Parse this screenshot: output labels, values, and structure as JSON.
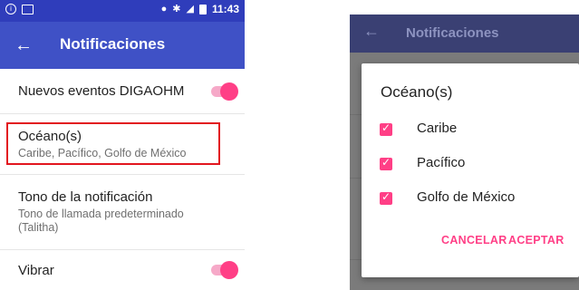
{
  "left_screen": {
    "statusbar": {
      "time": "11:43",
      "left_icons": [
        "info-icon",
        "image-icon"
      ],
      "right_icons": [
        "location-icon",
        "bluetooth-icon",
        "signal-icon",
        "battery-icon"
      ]
    },
    "appbar": {
      "title": "Notificaciones"
    },
    "settings": [
      {
        "label": "Nuevos eventos DIGAOHM",
        "toggle_on": true
      },
      {
        "label": "Océano(s)",
        "summary": "Caribe, Pacífico, Golfo de México"
      },
      {
        "label": "Tono de la notificación",
        "summary": "Tono de llamada predeterminado (Talitha)"
      },
      {
        "label": "Vibrar",
        "toggle_on": true
      }
    ],
    "accent_color": "#ff3f86",
    "appbar_color": "#3f51c6",
    "highlight_color": "#e2161f"
  },
  "right_screen": {
    "appbar": {
      "title": "Notificaciones"
    },
    "dialog": {
      "title": "Océano(s)",
      "options": [
        {
          "label": "Caribe",
          "checked": true
        },
        {
          "label": "Pacífico",
          "checked": true
        },
        {
          "label": "Golfo de México",
          "checked": true
        }
      ],
      "cancel_label": "CANCELAR",
      "accept_label": "ACEPTAR"
    }
  }
}
